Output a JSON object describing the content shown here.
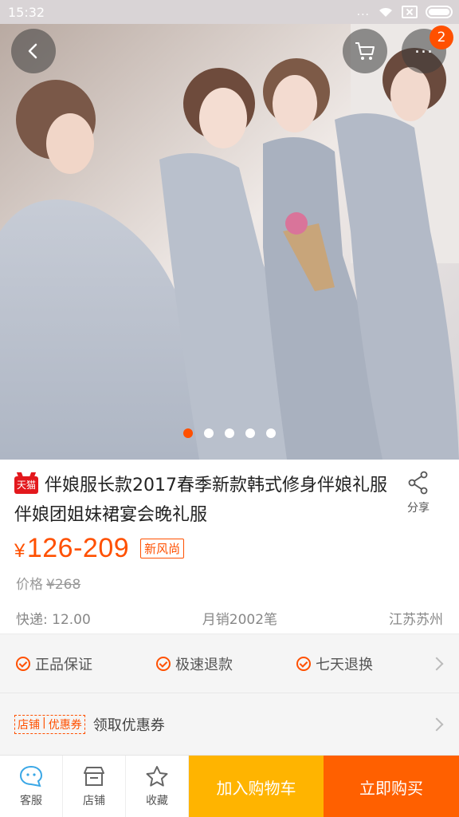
{
  "status_bar": {
    "time": "15:32",
    "signal_dots": "..."
  },
  "hero": {
    "image_alt": "伴娘服长款2017春季新款韩式修身伴娘礼服伴娘团姐妹裙宴会晚礼服",
    "page_count": 5,
    "active_page": 1,
    "cart_badge": "2",
    "more_dots": "..."
  },
  "product": {
    "store_badge": "天猫",
    "title": "伴娘服长款2017春季新款韩式修身伴娘礼服伴娘团姐妹裙宴会晚礼服",
    "share_label": "分享",
    "price_symbol": "¥",
    "price": "126-209",
    "new_tag": "新风尚",
    "orig_label": "价格",
    "orig_price": "¥268",
    "shipping": "快递: 12.00",
    "monthly_sales": "月销2002笔",
    "location": "江苏苏州"
  },
  "services": [
    "正品保证",
    "极速退款",
    "七天退换"
  ],
  "coupon": {
    "tag_left": "店铺",
    "tag_right": "优惠券",
    "text": "领取优惠券"
  },
  "bottom_bar": {
    "service_label": "客服",
    "store_label": "店铺",
    "favorite_label": "收藏",
    "add_to_cart": "加入购物车",
    "buy_now": "立即购买"
  },
  "colors": {
    "accent": "#ff5000",
    "cart_cta": "#ffb400",
    "buy_cta": "#ff6000"
  },
  "icons": [
    "back-icon",
    "cart-icon",
    "more-icon",
    "share-icon",
    "chat-icon",
    "store-icon",
    "star-icon"
  ]
}
